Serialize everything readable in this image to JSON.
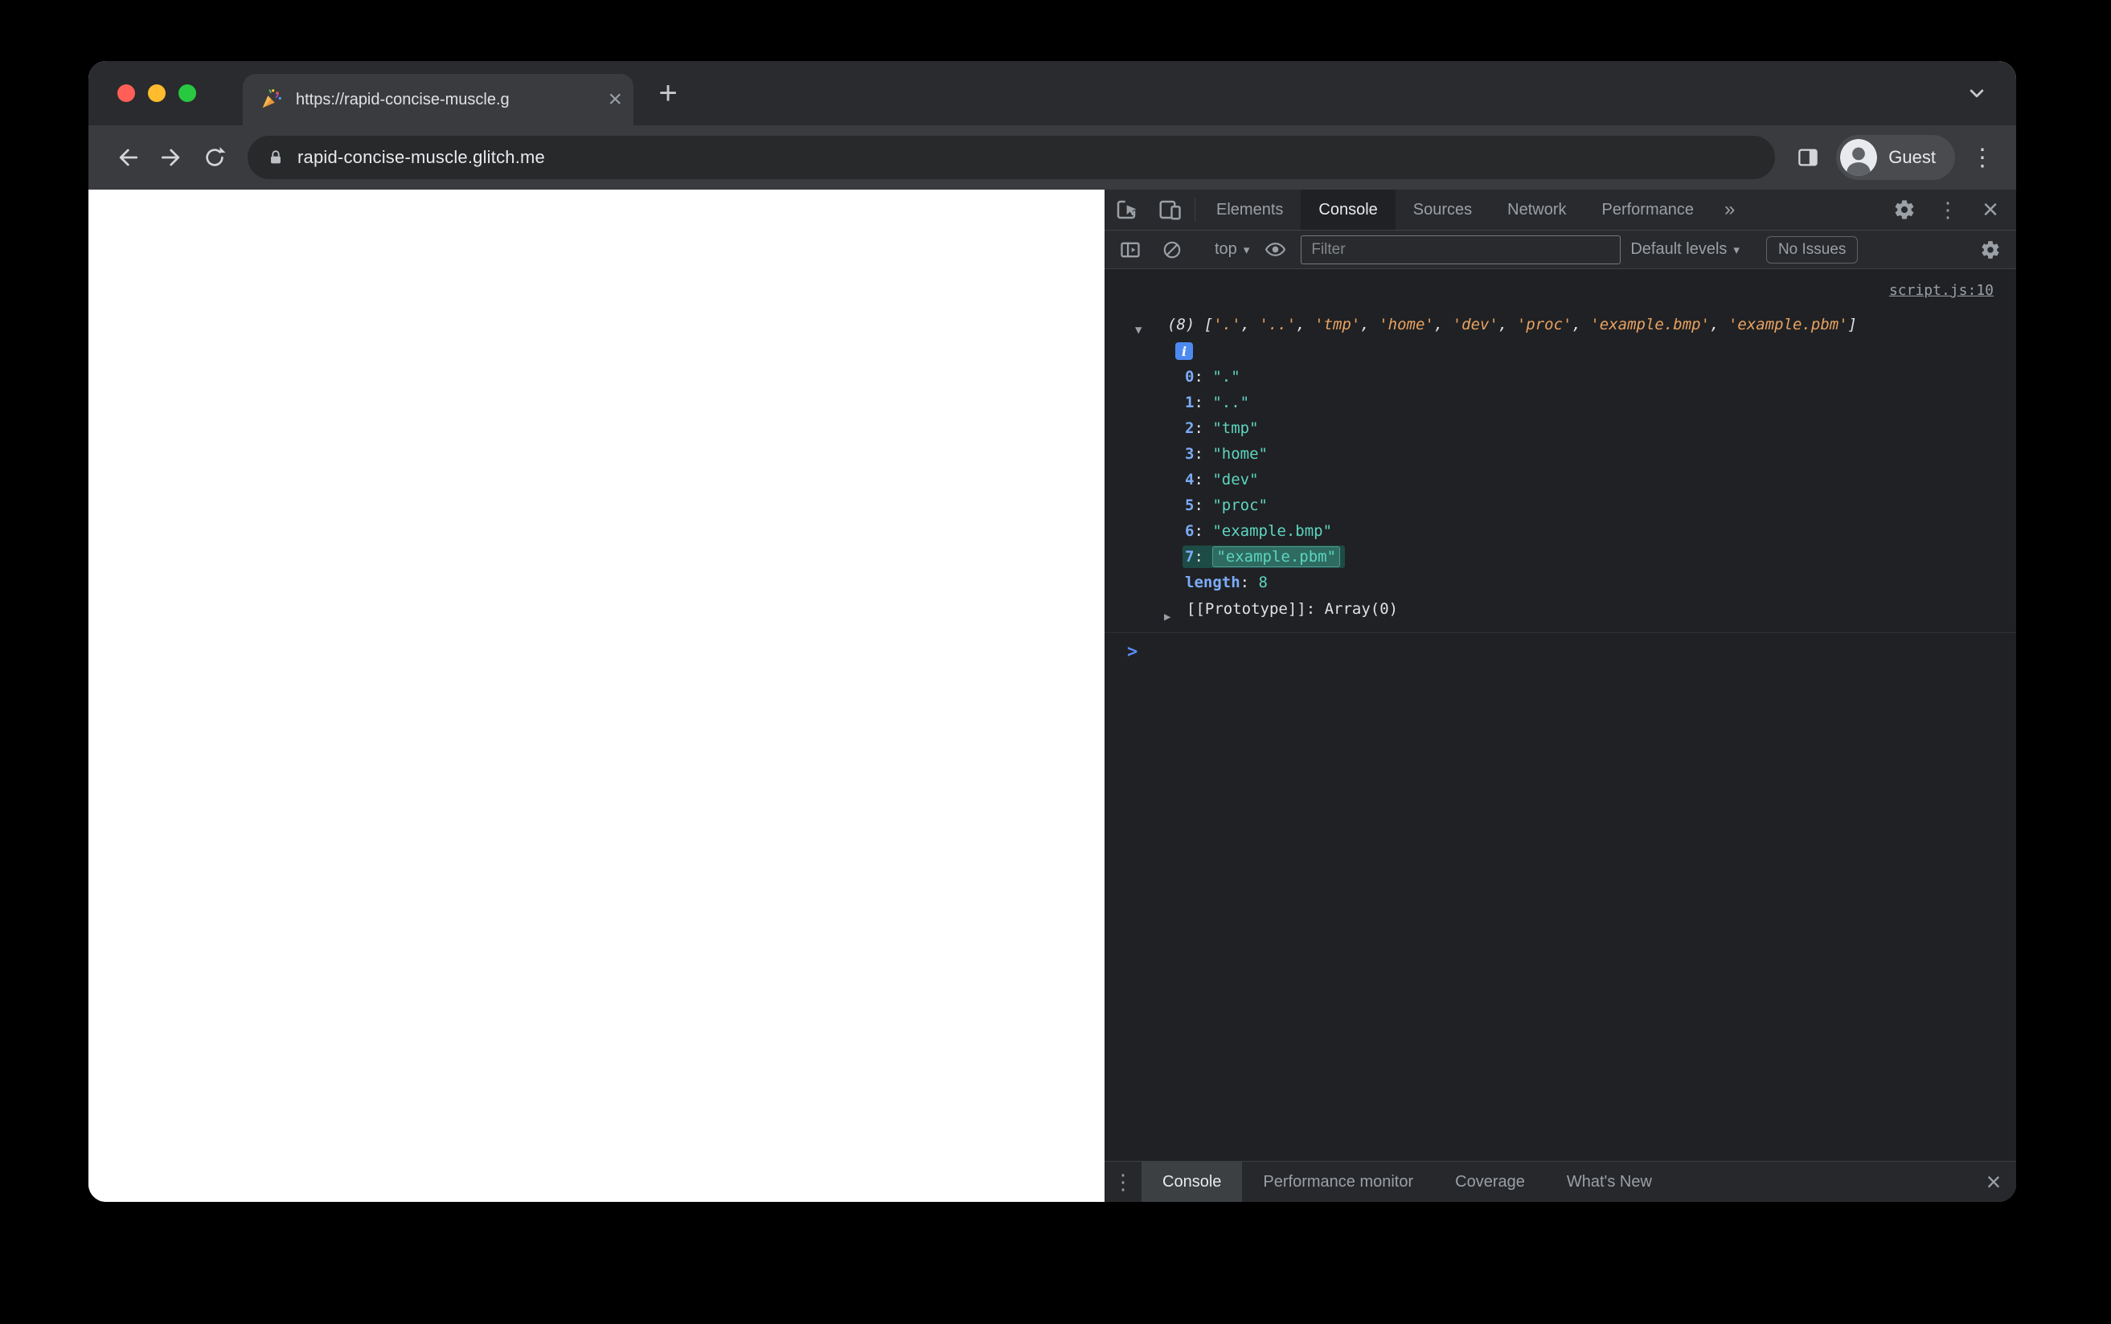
{
  "browser": {
    "tab_title": "https://rapid-concise-muscle.g",
    "address": "rapid-concise-muscle.glitch.me",
    "profile_label": "Guest"
  },
  "devtools": {
    "panel_tabs": [
      "Elements",
      "Console",
      "Sources",
      "Network",
      "Performance"
    ],
    "active_panel": "Console",
    "toolbar": {
      "context": "top",
      "filter_placeholder": "Filter",
      "levels_label": "Default levels",
      "issues_label": "No Issues"
    },
    "console": {
      "source_link": "script.js:10",
      "count": 8,
      "values": [
        ".",
        "..",
        "tmp",
        "home",
        "dev",
        "proc",
        "example.bmp",
        "example.pbm"
      ],
      "highlighted_index": 7,
      "length_label": "length",
      "length_value": "8",
      "prototype_label": "[[Prototype]]",
      "prototype_value": "Array(0)"
    },
    "drawer_tabs": [
      "Console",
      "Performance monitor",
      "Coverage",
      "What's New"
    ],
    "drawer_active": "Console"
  },
  "icons": {
    "tab_favicon": "party-popper",
    "address_security": "lock",
    "profile_avatar": "guest-person",
    "console_message_badge": "info"
  },
  "colors": {
    "traffic_red": "#ff5f57",
    "traffic_yellow": "#febc2e",
    "traffic_green": "#28c840",
    "index_blue": "#7cacf8",
    "string_teal": "#5dd5c0",
    "preview_orange": "#e8a361",
    "prompt_blue": "#5a8df5",
    "highlight_bg": "#1d4b46"
  }
}
